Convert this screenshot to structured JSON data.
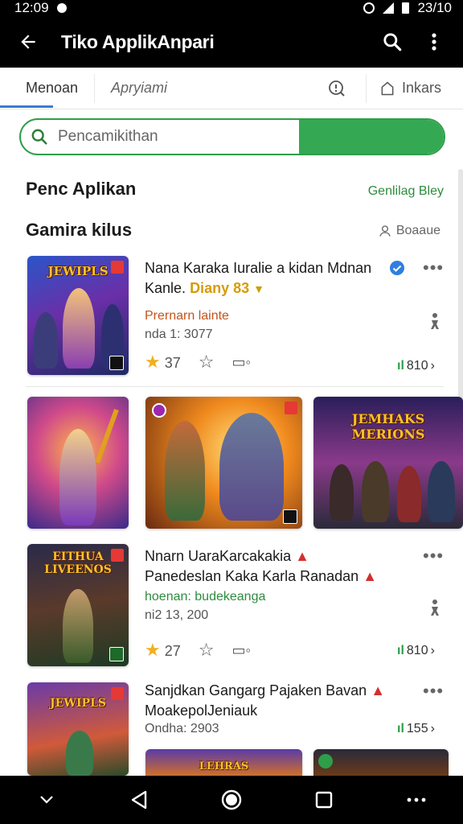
{
  "status_bar": {
    "time": "12:09",
    "right_text": "23/10"
  },
  "app_bar": {
    "title": "Tiko ApplikAnpari",
    "back_icon": "arrow-left-icon",
    "search_icon": "search-icon",
    "menu_icon": "more-vert-icon"
  },
  "tabs": [
    {
      "label": "Menoan"
    },
    {
      "label": "Apryiami"
    },
    {
      "label": ""
    },
    {
      "label": "Inkars"
    }
  ],
  "search": {
    "placeholder": "Pencamikithan"
  },
  "section1": {
    "title": "Penc Aplikan",
    "link": "Genlilag Bley"
  },
  "section2": {
    "title": "Gamira kilus",
    "link": "Boaaue"
  },
  "items": [
    {
      "title": "Nana Karaka Iuralie a kidan Mdnan",
      "subtitle_dark": "Kanle.",
      "subtitle_accent": "Diany 83",
      "developer": "Prernarn lainte",
      "meta": "nda 1: 3077",
      "rating": "37",
      "downloads": "810"
    },
    {
      "title": "Nnarn UaraKarcakakia",
      "title2": "Panedeslan Kaka Karla Ranadan",
      "developer": "hoenan: budekeanga",
      "meta": "ni2 13, 200",
      "rating": "27",
      "downloads": "810"
    },
    {
      "title": "Sanjdkan Gangarg Pajaken Bavan",
      "subtitle": "MoakepolJeniauk",
      "meta": "Ondha: 2903",
      "downloads": "155"
    }
  ],
  "thumb_logos": [
    "JEWIPLS",
    "EITHUA LIVEENOS",
    "LEHRAS",
    "JEMHAKS MERIONS"
  ],
  "colors": {
    "accent_green": "#34a853",
    "link_green": "#2e8b3e",
    "tab_underline": "#3a7bd5",
    "bar_bg": "#000000"
  }
}
